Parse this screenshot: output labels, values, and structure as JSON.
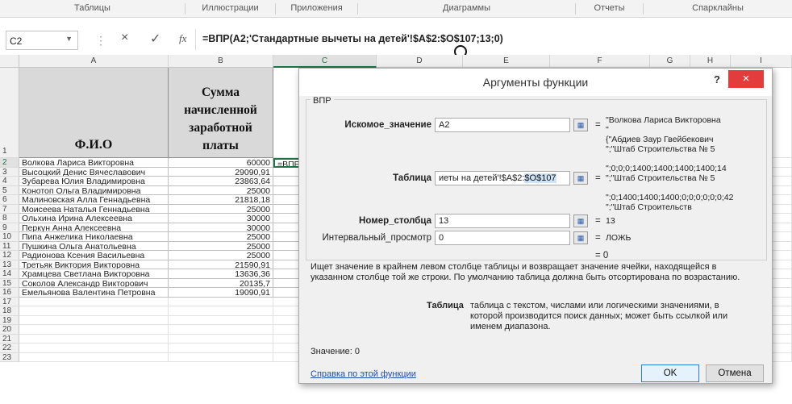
{
  "ribbon": {
    "groups": [
      "Таблицы",
      "Иллюстрации",
      "Приложения",
      "Диаграммы",
      "Отчеты",
      "Спарклайны"
    ]
  },
  "formula_bar": {
    "name_box": "C2",
    "cancel_icon": "×",
    "enter_icon": "✓",
    "fx_label": "fx",
    "formula": "=ВПР(A2;'Стандартные вычеты на детей'!$A$2:$O$107;13;0)"
  },
  "columns": [
    "A",
    "B",
    "C",
    "D",
    "E",
    "F",
    "G",
    "H",
    "I"
  ],
  "sheet": {
    "header_a": "Ф.И.О",
    "header_b_lines": [
      "Сумма",
      "начисленной",
      "заработной",
      "платы"
    ],
    "row_numbers": [
      "1",
      "2",
      "3",
      "4",
      "5",
      "6",
      "7",
      "8",
      "9",
      "10",
      "11",
      "12",
      "13",
      "14",
      "15",
      "16",
      "17",
      "18",
      "19",
      "20",
      "21",
      "22",
      "23"
    ],
    "rows": [
      {
        "name": "Волкова Лариса Викторовна",
        "sum": "60000",
        "c": "=ВПР("
      },
      {
        "name": "Высоцкий Денис Вячеславович",
        "sum": "29090,91",
        "c": ""
      },
      {
        "name": "Зубарева Юлия Владимировна",
        "sum": "23863,64",
        "c": ""
      },
      {
        "name": "Конотоп Ольга Владимировна",
        "sum": "25000",
        "c": ""
      },
      {
        "name": "Малиновская Алла Геннадьевна",
        "sum": "21818,18",
        "c": ""
      },
      {
        "name": "Моисеева Наталья Геннадьевна",
        "sum": "25000",
        "c": ""
      },
      {
        "name": "Ольхина Ирина Алексеевна",
        "sum": "30000",
        "c": ""
      },
      {
        "name": "Перкун Анна Алексеевна",
        "sum": "30000",
        "c": ""
      },
      {
        "name": "Пипа Анжелика Николаевна",
        "sum": "25000",
        "c": ""
      },
      {
        "name": "Пушкина Ольга Анатольевна",
        "sum": "25000",
        "c": ""
      },
      {
        "name": "Радионова Ксения Васильевна",
        "sum": "25000",
        "c": ""
      },
      {
        "name": "Третьяк Виктория Викторовна",
        "sum": "21590,91",
        "c": ""
      },
      {
        "name": "Храмцева Светлана Викторовна",
        "sum": "13636,36",
        "c": ""
      },
      {
        "name": "Соколов Александр Викторович",
        "sum": "20135,7",
        "c": ""
      },
      {
        "name": "Емельянова Валентина Петровна",
        "sum": "19090,91",
        "c": ""
      }
    ]
  },
  "dialog": {
    "title": "Аргументы функции",
    "help": "?",
    "close": "×",
    "function_name": "ВПР",
    "args": [
      {
        "label": "Искомое_значение",
        "input": "A2",
        "eq": "=",
        "result": "\"Волкова Лариса Викторовна\n\""
      },
      {
        "label": "Таблица",
        "input_pre": "иеты на детей'!$A$2:",
        "input_hl": "$O$107",
        "eq": "=",
        "result": "{\"Абдиев Заур Гвейбекович\n\";\"Штаб Строительства № 5\n\n\";0;0;0;1400;1400;1400;1400;14\n\";\"Штаб Строительства № 5\n\n\";0;1400;1400;1400;0;0;0;0;0;0;42\n\";\"Штаб Строительств"
      },
      {
        "label": "Номер_столбца",
        "input": "13",
        "eq": "=",
        "result": "13"
      },
      {
        "label": "Интервальный_просмотр",
        "input": "0",
        "eq": "=",
        "result": "ЛОЖЬ"
      }
    ],
    "total_eq": "= 0",
    "description": "Ищет значение в крайнем левом столбце таблицы и возвращает значение ячейки, находящейся в указанном столбце той же строки. По умолчанию таблица должна быть отсортирована по возрастанию.",
    "arg_desc_label": "Таблица",
    "arg_desc": "таблица с текстом, числами или логическими значениями, в которой производится поиск данных; может быть ссылкой или именем диапазона.",
    "value_text": "Значение:  0",
    "help_link": "Справка по этой функции",
    "ok": "OK",
    "cancel": "Отмена"
  }
}
